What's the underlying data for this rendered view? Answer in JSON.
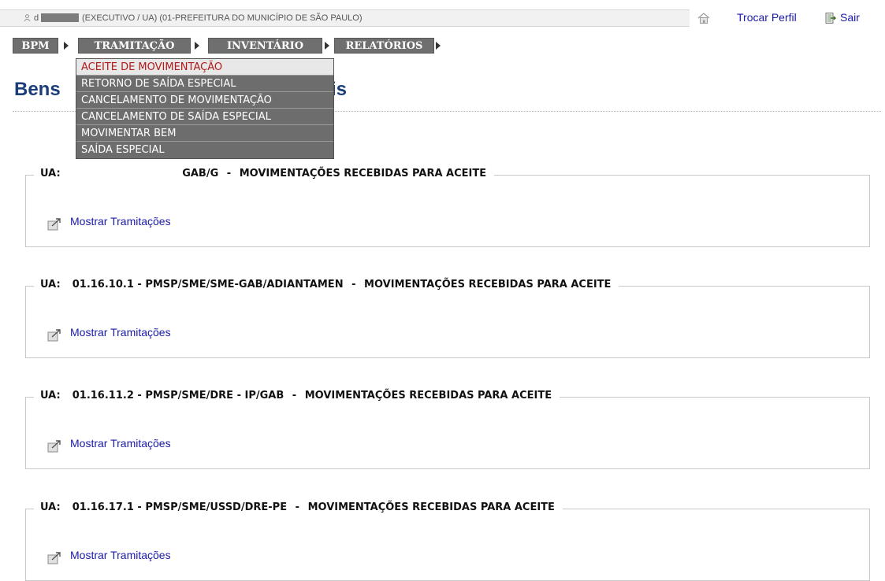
{
  "header": {
    "user_prefix": "d",
    "user_profile": "(EXECUTIVO / UA) (01-PREFEITURA DO MUNICÍPIO DE SÃO PAULO)",
    "trocar_perfil": "Trocar Perfil",
    "sair": "Sair",
    "icons": [
      "user-icon",
      "home-icon",
      "exit-icon"
    ]
  },
  "menu": {
    "items": [
      "BPM",
      "TRAMITAÇÃO",
      "INVENTÁRIO",
      "RELATÓRIOS"
    ],
    "colors": {
      "background": "#6f6f6f",
      "text": "#ffffff"
    }
  },
  "dropdown": {
    "items": [
      "ACEITE DE MOVIMENTAÇÃO",
      "RETORNO DE SAÍDA ESPECIAL",
      "CANCELAMENTO DE MOVIMENTAÇÃO",
      "CANCELAMENTO DE SAÍDA ESPECIAL",
      "MOVIMENTAR BEM",
      "SAÍDA ESPECIAL"
    ],
    "active_index": 0,
    "active_color": "#b01a1a"
  },
  "page": {
    "title_start": "Bens",
    "title_end": "is",
    "title_color": "#1b3d78"
  },
  "sections": [
    {
      "prefix": "UA:",
      "code": "",
      "name": "GAB/G",
      "suffix": "MOVIMENTAÇÕES RECEBIDAS PARA ACEITE",
      "link": "Mostrar Tramitações"
    },
    {
      "prefix": "UA:",
      "code": "01.16.10.1",
      "name": "PMSP/SME/SME-GAB/ADIANTAMEN",
      "suffix": "MOVIMENTAÇÕES RECEBIDAS PARA ACEITE",
      "link": "Mostrar Tramitações"
    },
    {
      "prefix": "UA:",
      "code": "01.16.11.2",
      "name": "PMSP/SME/DRE - IP/GAB",
      "suffix": "MOVIMENTAÇÕES RECEBIDAS PARA ACEITE",
      "link": "Mostrar Tramitações"
    },
    {
      "prefix": "UA:",
      "code": "01.16.17.1",
      "name": "PMSP/SME/USSD/DRE-PE",
      "suffix": "MOVIMENTAÇÕES RECEBIDAS PARA ACEITE",
      "link": "Mostrar Tramitações"
    }
  ],
  "link_color": "#1a1aa8"
}
